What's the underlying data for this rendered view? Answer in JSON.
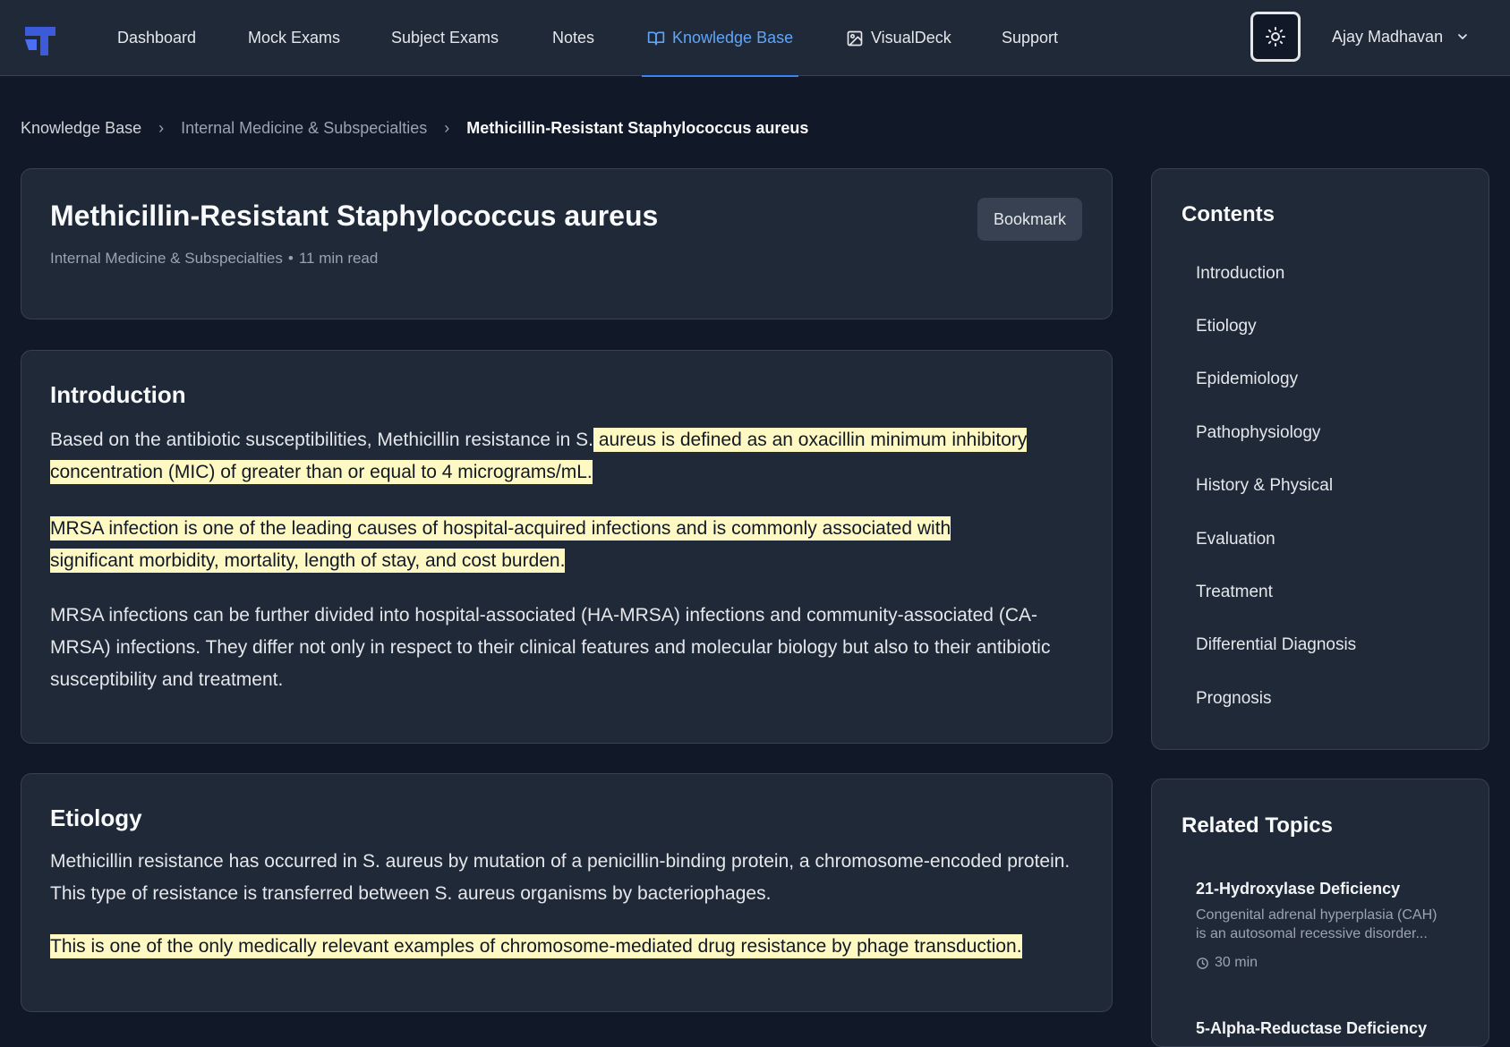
{
  "nav": {
    "items": [
      {
        "label": "Dashboard"
      },
      {
        "label": "Mock Exams"
      },
      {
        "label": "Subject Exams"
      },
      {
        "label": "Notes"
      },
      {
        "label": "Knowledge Base",
        "active": true,
        "icon": "book-open-icon"
      },
      {
        "label": "VisualDeck",
        "icon": "image-icon"
      },
      {
        "label": "Support"
      }
    ],
    "user_name": "Ajay Madhavan",
    "theme_icon": "sun-icon",
    "accent_color": "#60a5fa"
  },
  "breadcrumb": {
    "items": [
      "Knowledge Base",
      "Internal Medicine & Subspecialties",
      "Methicillin-Resistant Staphylococcus aureus"
    ]
  },
  "article": {
    "title": "Methicillin-Resistant Staphylococcus aureus",
    "category": "Internal Medicine & Subspecialties",
    "separator": "•",
    "read_time": "11 min read",
    "bookmark_label": "Bookmark"
  },
  "sections": {
    "introduction": {
      "title": "Introduction",
      "p1_plain": "Based on the antibiotic susceptibilities, Methicillin resistance in S.",
      "p1_highlight": " aureus is defined as an oxacillin minimum inhibitory concentration (MIC) of greater than or equal to 4 micrograms/mL.",
      "p2_highlight": " MRSA infection is one of the leading causes of hospital-acquired infections and is commonly associated with significant morbidity, mortality, length of stay, and cost burden.",
      "p3": "MRSA infections can be further divided into hospital-associated (HA-MRSA) infections and community-associated (CA-MRSA) infections. They differ not only in respect to their clinical features and molecular biology but also to their antibiotic susceptibility and treatment."
    },
    "etiology": {
      "title": "Etiology",
      "p1": "Methicillin resistance has occurred in S. aureus by mutation of a penicillin-binding protein, a chromosome-encoded protein. This type of resistance is transferred between S. aureus organisms by bacteriophages.",
      "p2_highlight": " This is one of the only medically relevant examples of chromosome-mediated drug resistance by phage transduction."
    }
  },
  "toc": {
    "title": "Contents",
    "items": [
      "Introduction",
      "Etiology",
      "Epidemiology",
      "Pathophysiology",
      "History & Physical",
      "Evaluation",
      "Treatment",
      "Differential Diagnosis",
      "Prognosis"
    ]
  },
  "related": {
    "title": "Related Topics",
    "items": [
      {
        "title": "21-Hydroxylase Deficiency",
        "desc": "Congenital adrenal hyperplasia (CAH) is an autosomal recessive disorder...",
        "time": "30 min"
      },
      {
        "title": "5-Alpha-Reductase Deficiency"
      }
    ]
  },
  "colors": {
    "highlight": "#fef9c3",
    "background": "#111827",
    "card": "#1f2937"
  }
}
